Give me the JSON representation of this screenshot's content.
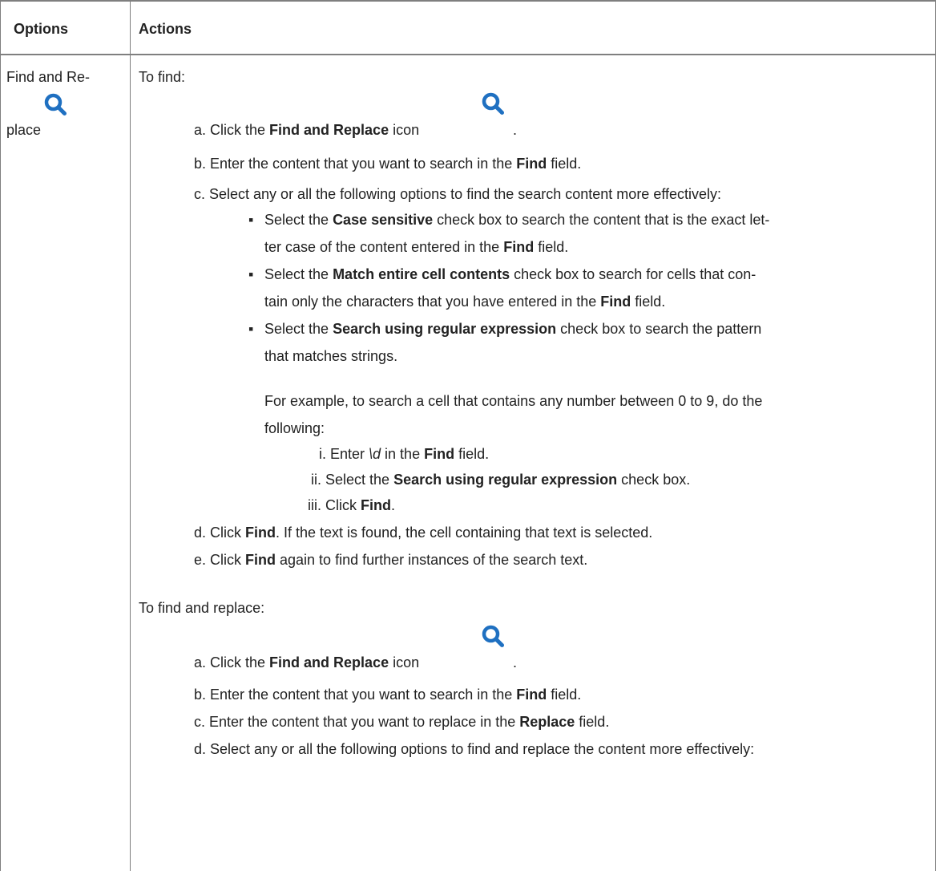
{
  "table": {
    "headers": {
      "options": "Options",
      "actions": "Actions"
    },
    "option_name_part1": "Find and Re-",
    "option_name_part2": "place",
    "option_icon": "search-icon"
  },
  "find_section": {
    "intro": "To find:",
    "step_a": {
      "prefix": "a. Click the ",
      "bold": "Find and Replace",
      "suffix": " icon",
      "icon": "search-icon",
      "after_icon": "."
    },
    "step_b": {
      "prefix": "b. Enter the content that you want to search in the ",
      "bold": "Find",
      "suffix": " field."
    },
    "step_c": "c. Select any or all the following options to find the search content more effectively:",
    "bullets": [
      {
        "marker": "▪",
        "prefix": "Select the ",
        "bold": "Case sensitive",
        "suffix": " check box to search the content that is the exact let-",
        "line2_prefix": "ter case of the content entered in the ",
        "line2_bold": "Find",
        "line2_suffix": " field."
      },
      {
        "marker": "▪",
        "prefix": "Select the ",
        "bold": "Match entire cell contents",
        "suffix": " check box to search for cells that con-",
        "line2_prefix": "tain only the characters that you have entered in the ",
        "line2_bold": "Find",
        "line2_suffix": " field."
      },
      {
        "marker": "▪",
        "prefix": "Select the ",
        "bold": "Search using regular expression",
        "suffix": " check box to search the pattern",
        "line2": "that matches strings."
      }
    ],
    "example_line1": "For example, to search a cell that contains any number between 0 to 9, do the",
    "example_line2": "following:",
    "substeps": {
      "i": {
        "prefix": "i. Enter ",
        "italic": "\\d",
        "mid": " in the ",
        "bold": "Find",
        "suffix": " field."
      },
      "ii": {
        "prefix": "ii. Select the ",
        "bold": "Search using regular expression",
        "suffix": " check box."
      },
      "iii": {
        "prefix": "iii. Click ",
        "bold": "Find",
        "suffix": "."
      }
    },
    "step_d": {
      "prefix": "d. Click ",
      "bold": "Find",
      "suffix": ". If the text is found, the cell containing that text is selected."
    },
    "step_e": {
      "prefix": "e. Click ",
      "bold": "Find",
      "suffix": " again to find further instances of the search text."
    }
  },
  "replace_section": {
    "intro": "To find and replace:",
    "step_a": {
      "prefix": "a. Click the ",
      "bold": "Find and Replace",
      "suffix": " icon",
      "icon": "search-icon",
      "after_icon": "."
    },
    "step_b": {
      "prefix": "b. Enter the content that you want to search in the ",
      "bold": "Find",
      "suffix": " field."
    },
    "step_c": {
      "prefix": "c. Enter the content that you want to replace in the ",
      "bold": "Replace",
      "suffix": " field."
    },
    "step_d": "d. Select any or all the following options to find and replace the content more effectively:"
  },
  "colors": {
    "icon": "#1f70c1",
    "border": "#7f7f7f",
    "text": "#222222"
  }
}
